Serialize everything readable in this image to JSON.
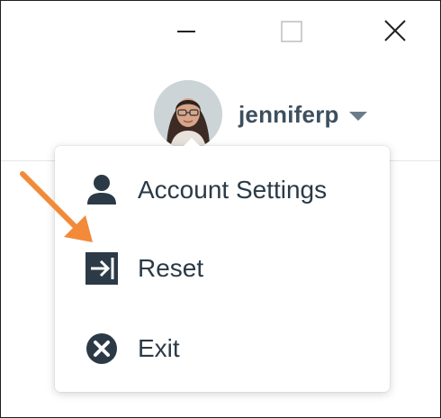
{
  "window": {
    "buttons": [
      "minimize",
      "maximize",
      "close"
    ]
  },
  "user": {
    "name": "jenniferp"
  },
  "menu": {
    "items": [
      {
        "label": "Account Settings",
        "icon": "user-icon"
      },
      {
        "label": "Reset",
        "icon": "sign-in-arrow-icon"
      },
      {
        "label": "Exit",
        "icon": "close-circle-icon"
      }
    ]
  },
  "colors": {
    "text_dark": "#2b3a46",
    "username": "#3d4f5e",
    "caret": "#6b7b88",
    "annotation": "#f28a3a"
  }
}
